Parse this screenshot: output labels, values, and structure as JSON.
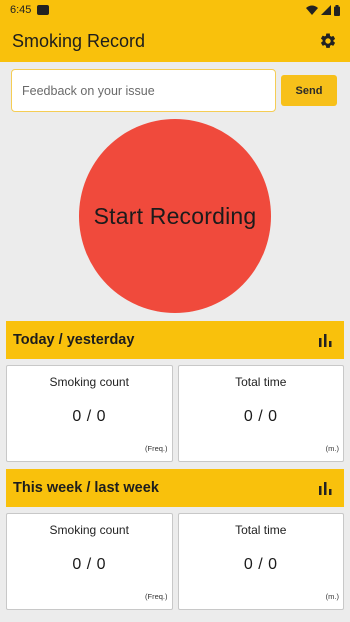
{
  "status_bar": {
    "time": "6:45"
  },
  "app_bar": {
    "title": "Smoking Record",
    "settings_icon": "gear-icon"
  },
  "feedback": {
    "placeholder": "Feedback on your issue",
    "value": "",
    "send_label": "Send"
  },
  "record": {
    "label": "Start Recording",
    "color": "#f04a3c"
  },
  "sections": [
    {
      "title": "Today / yesterday",
      "chart_icon": "bar-chart-icon",
      "cards": [
        {
          "title": "Smoking count",
          "value": "0 / 0",
          "unit": "(Freq.)"
        },
        {
          "title": "Total time",
          "value": "0 / 0",
          "unit": "(m.)"
        }
      ]
    },
    {
      "title": "This week / last week",
      "chart_icon": "bar-chart-icon",
      "cards": [
        {
          "title": "Smoking count",
          "value": "0 / 0",
          "unit": "(Freq.)"
        },
        {
          "title": "Total time",
          "value": "0 / 0",
          "unit": "(m.)"
        }
      ]
    }
  ],
  "colors": {
    "accent": "#f9c10c",
    "background": "#ececec"
  }
}
